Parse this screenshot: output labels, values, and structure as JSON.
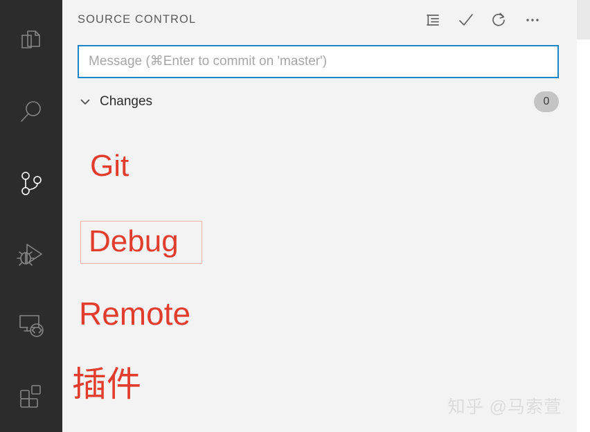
{
  "theme": {
    "activity_bar_bg": "#2c2c2c",
    "panel_bg": "#f3f3f3",
    "icon_inactive": "#868686",
    "icon_active": "#ffffff",
    "input_focus_border": "#1a85c9",
    "annotation_red": "#e23c2c",
    "annotation_box_border": "#efb2ab",
    "badge_bg": "#c4c4c4",
    "watermark_color": "#dcdcdc",
    "editor_tabbar_bg": "#e8e8e8"
  },
  "activity_bar": {
    "items": [
      {
        "name": "explorer",
        "icon": "files-icon",
        "label": "Explorer",
        "active": false
      },
      {
        "name": "search",
        "icon": "search-icon",
        "label": "Search",
        "active": false
      },
      {
        "name": "source-control",
        "icon": "source-control-icon",
        "label": "Source Control",
        "active": true
      },
      {
        "name": "run-debug",
        "icon": "run-and-debug-icon",
        "label": "Run and Debug",
        "active": false
      },
      {
        "name": "remote-explorer",
        "icon": "remote-explorer-icon",
        "label": "Remote Explorer",
        "active": false
      },
      {
        "name": "extensions",
        "icon": "extensions-icon",
        "label": "Extensions",
        "active": false
      }
    ]
  },
  "panel": {
    "title": "SOURCE CONTROL",
    "actions": [
      {
        "name": "view-as-list-button",
        "icon": "view-as-list-icon",
        "label": "View as List"
      },
      {
        "name": "commit-button",
        "icon": "check-icon",
        "label": "Commit"
      },
      {
        "name": "refresh-button",
        "icon": "refresh-icon",
        "label": "Refresh"
      },
      {
        "name": "more-actions-button",
        "icon": "ellipsis-icon",
        "label": "More Actions..."
      }
    ],
    "commit_input": {
      "value": "",
      "placeholder": "Message (⌘Enter to commit on 'master')"
    },
    "changes": {
      "chevron": "chevron-down-icon",
      "label": "Changes",
      "count": "0"
    }
  },
  "annotations": {
    "git": "Git",
    "debug": "Debug",
    "remote": "Remote",
    "plugin": "插件"
  },
  "watermark": {
    "text": "知乎 @马索萱"
  }
}
